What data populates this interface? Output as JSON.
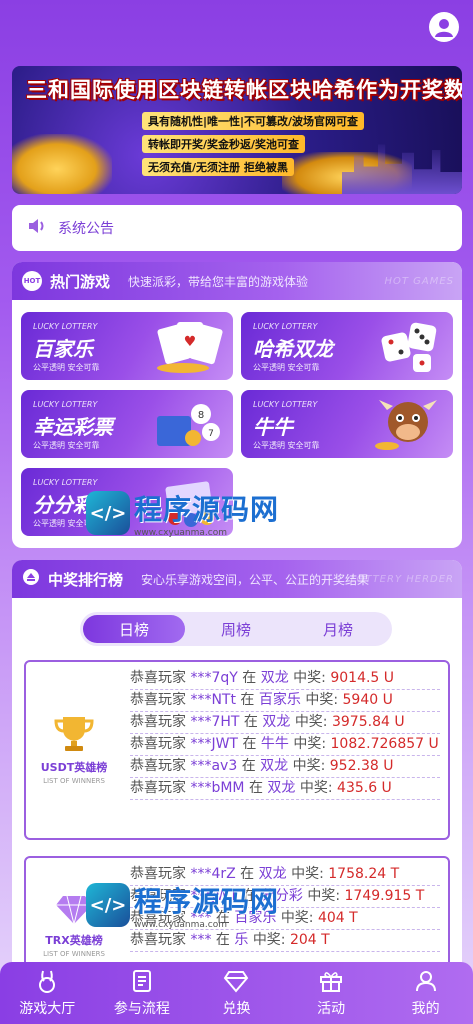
{
  "banner": {
    "title": "三和国际使用区块链转帐区块哈希作为开奖数据",
    "lines": [
      "具有随机性|唯一性|不可篡改/波场官网可查",
      "转帐即开奖/奖金秒返/奖池可查",
      "无须充值/无须注册 拒绝被黑"
    ]
  },
  "notice": {
    "label": "系统公告"
  },
  "hot_games": {
    "title": "热门游戏",
    "subtitle": "快速派彩，带给您丰富的游戏体验",
    "ghost": "HOT GAMES",
    "badge": "HOT",
    "cards": [
      {
        "lucky": "LUCKY LOTTERY",
        "name": "百家乐",
        "sub": "公平透明 安全可靠"
      },
      {
        "lucky": "LUCKY LOTTERY",
        "name": "哈希双龙",
        "sub": "公平透明 安全可靠"
      },
      {
        "lucky": "LUCKY LOTTERY",
        "name": "幸运彩票",
        "sub": "公平透明 安全可靠"
      },
      {
        "lucky": "LUCKY LOTTERY",
        "name": "牛牛",
        "sub": "公平透明 安全可靠"
      },
      {
        "lucky": "LUCKY LOTTERY",
        "name": "分分彩",
        "sub": "公平透明 安全可靠"
      }
    ]
  },
  "ranking": {
    "title": "中奖排行榜",
    "subtitle": "安心乐享游戏空间，公平、公正的开奖结果",
    "ghost": "LOTTERY HERDER",
    "tabs": [
      "日榜",
      "周榜",
      "月榜"
    ],
    "usdt": {
      "name": "USDT英雄榜",
      "name_en": "LIST OF WINNERS",
      "rows": [
        {
          "prefix": "恭喜玩家",
          "user": "***7qY",
          "mid": "在",
          "game": "双龙",
          "label": "中奖:",
          "amount": "9014.5 U"
        },
        {
          "prefix": "恭喜玩家",
          "user": "***NTt",
          "mid": "在",
          "game": "百家乐",
          "label": "中奖:",
          "amount": "5940 U"
        },
        {
          "prefix": "恭喜玩家",
          "user": "***7HT",
          "mid": "在",
          "game": "双龙",
          "label": "中奖:",
          "amount": "3975.84 U"
        },
        {
          "prefix": "恭喜玩家",
          "user": "***JWT",
          "mid": "在",
          "game": "牛牛",
          "label": "中奖:",
          "amount": "1082.726857 U"
        },
        {
          "prefix": "恭喜玩家",
          "user": "***av3",
          "mid": "在",
          "game": "双龙",
          "label": "中奖:",
          "amount": "952.38 U"
        },
        {
          "prefix": "恭喜玩家",
          "user": "***bMM",
          "mid": "在",
          "game": "双龙",
          "label": "中奖:",
          "amount": "435.6 U"
        }
      ]
    },
    "trx": {
      "name": "TRX英雄榜",
      "name_en": "LIST OF WINNERS",
      "rows": [
        {
          "prefix": "恭喜玩家",
          "user": "***4rZ",
          "mid": "在",
          "game": "双龙",
          "label": "中奖:",
          "amount": "1758.24 T"
        },
        {
          "prefix": "恭喜玩家",
          "user": "***JWT",
          "mid": "在",
          "game": "分分彩",
          "label": "中奖:",
          "amount": "1749.915 T"
        },
        {
          "prefix": "恭喜玩家",
          "user": "***",
          "mid": "在",
          "game": "百家乐",
          "label": "中奖:",
          "amount": "404 T"
        },
        {
          "prefix": "恭喜玩家",
          "user": "***",
          "mid": "在",
          "game": "乐",
          "label": "中奖:",
          "amount": "204 T"
        }
      ]
    }
  },
  "watermark": {
    "main": "程序源码网",
    "url": "www.cxyuanma.com"
  },
  "nav": [
    {
      "label": "游戏大厅",
      "icon": "rabbit-icon"
    },
    {
      "label": "参与流程",
      "icon": "document-icon"
    },
    {
      "label": "兑换",
      "icon": "diamond-icon"
    },
    {
      "label": "活动",
      "icon": "gift-icon"
    },
    {
      "label": "我的",
      "icon": "user-icon"
    }
  ]
}
